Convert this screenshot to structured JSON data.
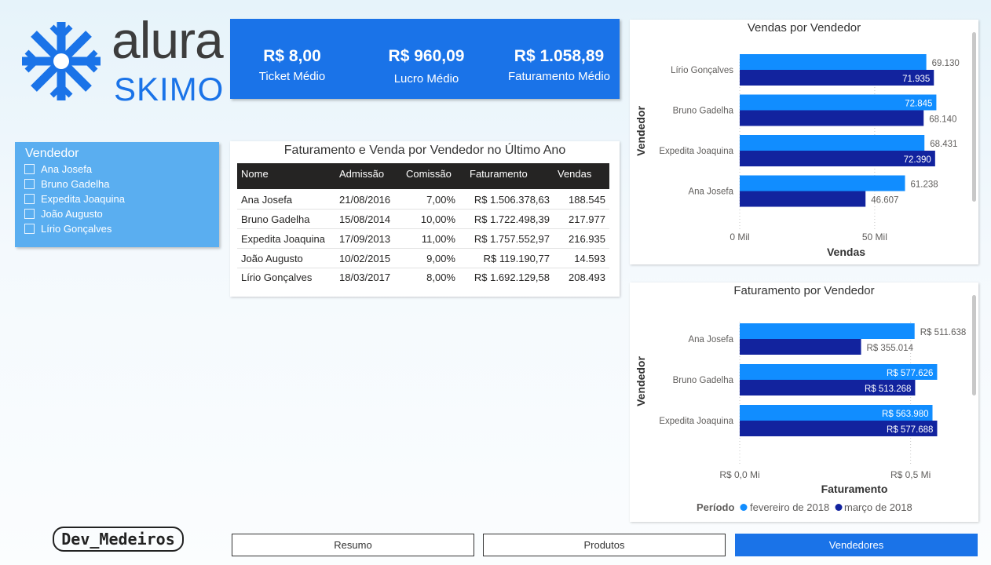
{
  "logo": {
    "top": "alura",
    "bottom": "SKIMO",
    "icon": "snowflake-icon",
    "color": "#1a73e8"
  },
  "kpis": [
    {
      "value": "R$ 8,00",
      "label": "Ticket Médio"
    },
    {
      "value": "R$ 960,09",
      "label": "Lucro Médio"
    },
    {
      "value": "R$ 1.058,89",
      "label": "Faturamento Médio"
    }
  ],
  "slicer": {
    "title": "Vendedor",
    "items": [
      "Ana Josefa",
      "Bruno Gadelha",
      "Expedita Joaquina",
      "João Augusto",
      "Lírio Gonçalves"
    ]
  },
  "table": {
    "title": "Faturamento e Venda por Vendedor no Último Ano",
    "headers": [
      "Nome",
      "Admissão",
      "Comissão",
      "Faturamento",
      "Vendas"
    ],
    "rows": [
      [
        "Ana Josefa",
        "21/08/2016",
        "7,00%",
        "R$ 1.506.378,63",
        "188.545"
      ],
      [
        "Bruno Gadelha",
        "15/08/2014",
        "10,00%",
        "R$ 1.722.498,39",
        "217.977"
      ],
      [
        "Expedita Joaquina",
        "17/09/2013",
        "11,00%",
        "R$ 1.757.552,97",
        "216.935"
      ],
      [
        "João Augusto",
        "10/02/2015",
        "9,00%",
        "R$ 119.190,77",
        "14.593"
      ],
      [
        "Lírio Gonçalves",
        "18/03/2017",
        "8,00%",
        "R$ 1.692.129,58",
        "208.493"
      ]
    ]
  },
  "legend": {
    "title": "Período"
  },
  "colors": {
    "feb": "#118dff",
    "mar": "#12239e",
    "accent": "#1a73e8"
  },
  "chart_data": [
    {
      "type": "bar",
      "orientation": "horizontal",
      "title": "Vendas por Vendedor",
      "ylabel": "Vendedor",
      "xlabel": "Vendas",
      "categories": [
        "Lírio Gonçalves",
        "Bruno Gadelha",
        "Expedita Joaquina",
        "Ana Josefa"
      ],
      "series": [
        {
          "name": "fevereiro de 2018",
          "values": [
            69130,
            72845,
            68431,
            61238
          ],
          "labels": [
            "69.130",
            "72.845",
            "68.431",
            "61.238"
          ]
        },
        {
          "name": "março de 2018",
          "values": [
            71935,
            68140,
            72390,
            46607
          ],
          "labels": [
            "71.935",
            "68.140",
            "72.390",
            "46.607"
          ]
        }
      ],
      "xticks": [
        {
          "value": 0,
          "label": "0 Mil"
        },
        {
          "value": 50000,
          "label": "50 Mil"
        }
      ],
      "xlim": [
        0,
        80000
      ],
      "grid": true
    },
    {
      "type": "bar",
      "orientation": "horizontal",
      "title": "Faturamento por Vendedor",
      "ylabel": "Vendedor",
      "xlabel": "Faturamento",
      "categories": [
        "Ana Josefa",
        "Bruno Gadelha",
        "Expedita Joaquina"
      ],
      "series": [
        {
          "name": "fevereiro de 2018",
          "values": [
            511638,
            577626,
            563980
          ],
          "labels": [
            "R$ 511.638",
            "R$ 577.626",
            "R$ 563.980"
          ]
        },
        {
          "name": "março de 2018",
          "values": [
            355014,
            513268,
            577688
          ],
          "labels": [
            "R$ 355.014",
            "R$ 513.268",
            "R$ 577.688"
          ]
        }
      ],
      "xticks": [
        {
          "value": 0,
          "label": "R$ 0,0 Mi"
        },
        {
          "value": 500000,
          "label": "R$ 0,5 Mi"
        }
      ],
      "xlim": [
        0,
        680000
      ],
      "grid": true,
      "legend_position": "bottom"
    }
  ],
  "signature": "Dev_Medeiros",
  "nav": [
    {
      "label": "Resumo",
      "active": false
    },
    {
      "label": "Produtos",
      "active": false
    },
    {
      "label": "Vendedores",
      "active": true
    }
  ]
}
